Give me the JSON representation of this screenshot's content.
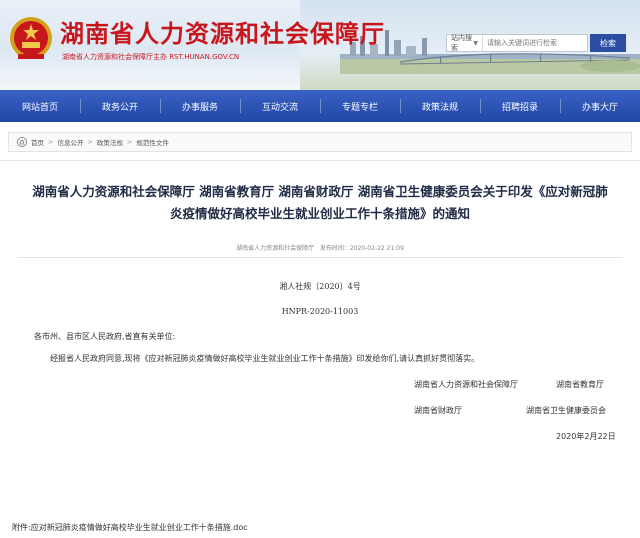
{
  "header": {
    "site_title": "湖南省人力资源和社会保障厅",
    "site_subtitle": "湖南省人力资源和社会保障厅主办  RST.HUNAN.GOV.CN",
    "search": {
      "scope": "站内搜索",
      "placeholder": "请输入关键词进行检索",
      "button_label": "检索"
    }
  },
  "nav": {
    "items": [
      {
        "label": "网站首页"
      },
      {
        "label": "政务公开"
      },
      {
        "label": "办事服务"
      },
      {
        "label": "互动交流"
      },
      {
        "label": "专题专栏"
      },
      {
        "label": "政策法规"
      },
      {
        "label": "招聘招录"
      },
      {
        "label": "办事大厅"
      }
    ]
  },
  "breadcrumb": {
    "items": [
      "首页",
      "信息公开",
      "政策法规",
      "规范性文件"
    ]
  },
  "article": {
    "title_line1": "湖南省人力资源和社会保障厅 湖南省教育厅 湖南省财政厅 湖南省卫生健康委员会关于印发《应对新冠肺",
    "title_line2": "炎疫情做好高校毕业生就业创业工作十条措施》的通知",
    "source": "湖南省人力资源和社会保障厅",
    "publish_label": "发布时间：",
    "publish_time": "2020-02-22 21:09",
    "doc_number": "湘人社规〔2020〕4号",
    "hnpr": "HNPR-2020-11003",
    "salutation": "各市州、县市区人民政府,省直有关单位:",
    "body": "经报省人民政府同意,现将《应对新冠肺炎疫情做好高校毕业生就业创业工作十条措施》印发给你们,请认真抓好贯彻落实。",
    "signatories": [
      "湖南省人力资源和社会保障厅",
      "湖南省教育厅",
      "湖南省财政厅",
      "湖南省卫生健康委员会"
    ],
    "date": "2020年2月22日",
    "attachment": "附件:应对新冠肺炎疫情做好高校毕业生就业创业工作十条措施.doc"
  },
  "colors": {
    "brand_red": "#c8161d",
    "nav_blue": "#2146a6"
  }
}
